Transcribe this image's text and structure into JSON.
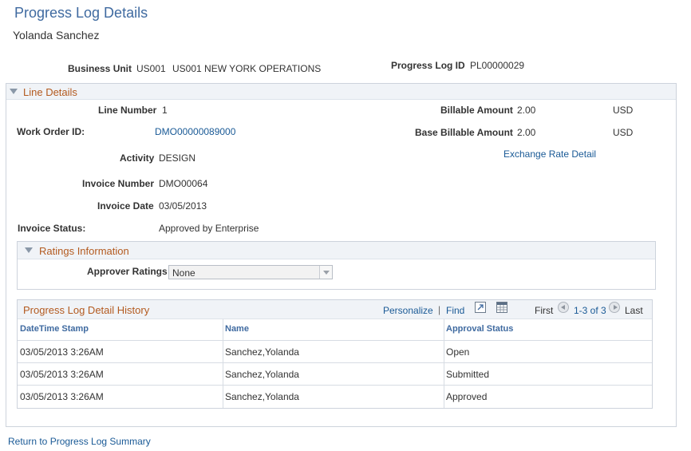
{
  "page": {
    "title": "Progress Log Details",
    "subtitle": "Yolanda Sanchez"
  },
  "header_fields": {
    "business_unit_label": "Business Unit",
    "business_unit_value": "US001",
    "business_unit_desc": "US001 NEW YORK OPERATIONS",
    "progress_log_id_label": "Progress Log ID",
    "progress_log_id_value": "PL00000029"
  },
  "line_details": {
    "title": "Line Details",
    "line_number_label": "Line Number",
    "line_number_value": "1",
    "work_order_label": "Work Order ID:",
    "work_order_value": "DMO00000089000",
    "activity_label": "Activity",
    "activity_value": "DESIGN",
    "invoice_number_label": "Invoice Number",
    "invoice_number_value": "DMO00064",
    "invoice_date_label": "Invoice Date",
    "invoice_date_value": "03/05/2013",
    "invoice_status_label": "Invoice Status:",
    "invoice_status_value": "Approved by Enterprise",
    "billable_amount_label": "Billable Amount",
    "billable_amount_value": "2.00",
    "billable_amount_currency": "USD",
    "base_billable_amount_label": "Base Billable Amount",
    "base_billable_amount_value": "2.00",
    "base_billable_amount_currency": "USD",
    "exchange_rate_link": "Exchange Rate Detail"
  },
  "ratings": {
    "title": "Ratings Information",
    "approver_ratings_label": "Approver Ratings",
    "approver_ratings_value": "None"
  },
  "history": {
    "title": "Progress Log Detail History",
    "personalize": "Personalize",
    "separator": "|",
    "find": "Find",
    "first": "First",
    "range": "1-3 of 3",
    "last": "Last",
    "columns": [
      "DateTime Stamp",
      "Name",
      "Approval Status"
    ],
    "rows": [
      [
        "03/05/2013  3:26AM",
        "Sanchez,Yolanda",
        "Open"
      ],
      [
        "03/05/2013  3:26AM",
        "Sanchez,Yolanda",
        "Submitted"
      ],
      [
        "03/05/2013  3:26AM",
        "Sanchez,Yolanda",
        "Approved"
      ]
    ]
  },
  "footer": {
    "return_link": "Return to Progress Log Summary"
  },
  "icons": {
    "expand": "view-all-icon",
    "download": "download-spreadsheet-icon",
    "prev": "previous-row-icon",
    "next": "next-row-icon",
    "collapse": "collapse-triangle-icon",
    "dropdown": "chevron-down-icon"
  },
  "colors": {
    "title_blue": "#3f6aa0",
    "section_orange": "#b35a1f",
    "link_blue": "#1a5a96"
  }
}
